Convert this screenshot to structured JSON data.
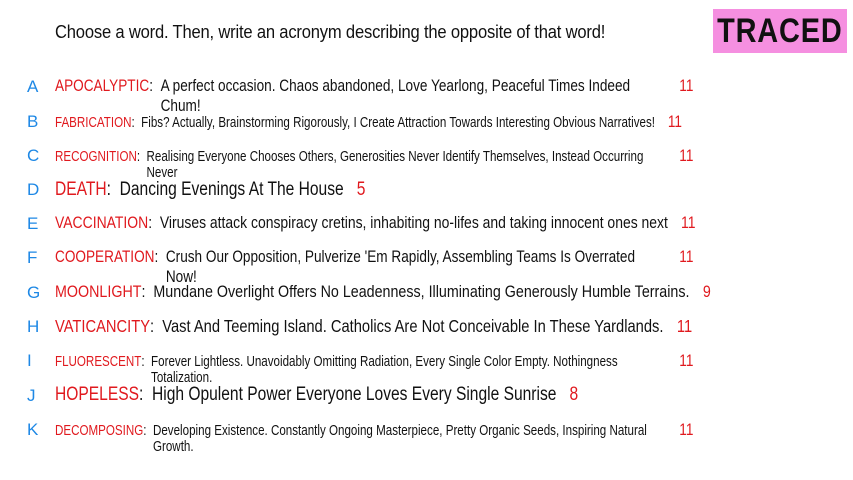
{
  "prompt": "Choose a word. Then, write an acronym describing the opposite of that word!",
  "badge": "TRACED",
  "colors": {
    "letter": "#1e88e5",
    "word": "#e0191e",
    "badge_bg": "#f58fe0"
  },
  "rows": [
    {
      "letter": "A",
      "word": "APOCALYPTIC",
      "phrase": "A perfect occasion. Chaos abandoned, Love Yearlong, Peaceful Times Indeed Chum!",
      "count": "11"
    },
    {
      "letter": "B",
      "word": "FABRICATION",
      "phrase": "Fibs? Actually, Brainstorming Rigorously, I Create Attraction Towards Interesting Obvious Narratives!",
      "count": "11"
    },
    {
      "letter": "C",
      "word": "RECOGNITION",
      "phrase": "Realising Everyone Chooses Others, Generosities Never Identify Themselves, Instead Occurring Never",
      "count": "11"
    },
    {
      "letter": "D",
      "word": "DEATH",
      "phrase": "Dancing Evenings At The House",
      "count": "5"
    },
    {
      "letter": "E",
      "word": "VACCINATION",
      "phrase": "Viruses attack conspiracy cretins, inhabiting no-lifes and taking innocent ones next",
      "count": "11"
    },
    {
      "letter": "F",
      "word": "COOPERATION",
      "phrase": "Crush Our Opposition, Pulverize 'Em Rapidly, Assembling Teams Is Overrated Now!",
      "count": "11"
    },
    {
      "letter": "G",
      "word": "MOONLIGHT",
      "phrase": "Mundane Overlight Offers No Leadenness, Illuminating Generously Humble Terrains.",
      "count": "9"
    },
    {
      "letter": "H",
      "word": "VATICANCITY",
      "phrase": "Vast And Teeming Island. Catholics Are Not Conceivable In These Yardlands.",
      "count": "11"
    },
    {
      "letter": "I",
      "word": "FLUORESCENT",
      "phrase": "Forever Lightless. Unavoidably Omitting Radiation, Every Single Color Empty. Nothingness Totalization.",
      "count": "11"
    },
    {
      "letter": "J",
      "word": "HOPELESS",
      "phrase": "High Opulent Power Everyone Loves Every Single Sunrise",
      "count": "8"
    },
    {
      "letter": "K",
      "word": "DECOMPOSING",
      "phrase": "Developing Existence. Constantly Ongoing Masterpiece, Pretty Organic Seeds, Inspiring Natural Growth.",
      "count": "11"
    }
  ]
}
